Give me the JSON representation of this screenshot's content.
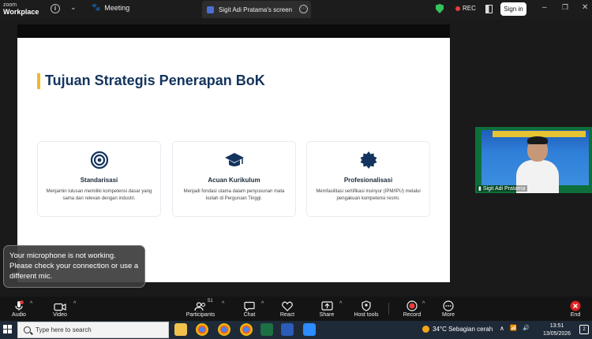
{
  "window": {
    "logo_top": "zoom",
    "logo_bottom": "Workplace",
    "meeting_label": "Meeting",
    "share_tab_label": "Sigit Adi Pratama's screen",
    "rec_label": "REC",
    "signin_label": "Sign in",
    "minimize_glyph": "–",
    "maximize_glyph": "❐",
    "close_glyph": "✕",
    "shield_color": "#35c25d",
    "rec_color": "#ee3b3b"
  },
  "slide": {
    "title": "Tujuan Strategis Penerapan BoK",
    "accent_color": "#f1b928",
    "title_color": "#13345e",
    "cards": [
      {
        "icon": "target-icon",
        "title": "Standarisasi",
        "desc": "Menjamin lulusan memiliki kompetensi dasar yang sama dan relevan dengan industri."
      },
      {
        "icon": "graduation-cap-icon",
        "title": "Acuan Kurikulum",
        "desc": "Menjadi fondasi utama dalam penyusunan mata kuliah di Perguruan Tinggi."
      },
      {
        "icon": "certificate-seal-icon",
        "title": "Profesionalisasi",
        "desc": "Memfasilitasi sertifikasi insinyur (IPM/IPU) melalui pengakuan kompetensi resmi."
      }
    ]
  },
  "video": {
    "participant_name": "Sigit Adi Pratama"
  },
  "toast": {
    "message": "Your microphone is not working. Please check your connection or use a different mic."
  },
  "toolbar": {
    "audio_label": "Audio",
    "video_label": "Video",
    "participants_label": "Participants",
    "participants_count": "51",
    "chat_label": "Chat",
    "react_label": "React",
    "share_label": "Share",
    "host_tools_label": "Host tools",
    "record_label": "Record",
    "more_label": "More",
    "end_label": "End"
  },
  "taskbar": {
    "search_placeholder": "Type here to search",
    "weather": "34°C  Sebagian cerah",
    "time": "13:51",
    "date": "13/05/2026",
    "notifications": "2",
    "tray_chevron": "∧",
    "tray_wifi": "📶",
    "tray_volume": "🔊"
  }
}
